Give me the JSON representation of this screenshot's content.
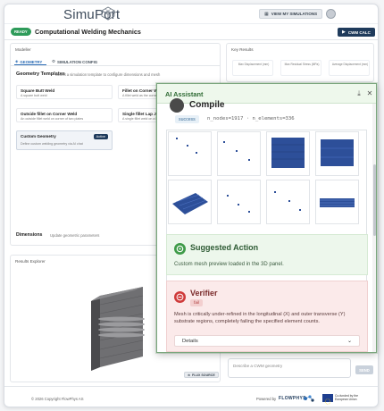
{
  "app": {
    "name": "SimuPort"
  },
  "header": {
    "view_simulations_label": "VIEW MY SIMULATIONS"
  },
  "titlebar": {
    "status_badge": "READY",
    "title": "Computational Welding Mechanics",
    "cwm_button_label": "CWM CALC"
  },
  "modeller": {
    "section_title": "Modeller",
    "tabs": [
      {
        "label": "GEOMETRY",
        "active": true
      },
      {
        "label": "SIMULATION CONFIG",
        "active": false
      }
    ],
    "geometry_templates_title": "Geometry Templates",
    "geometry_templates_sub": "Select a simulation template to configure dimensions and mesh",
    "templates": [
      {
        "title": "Square Butt Weld",
        "desc": "A square butt weld"
      },
      {
        "title": "Fillet on Corner Weld",
        "desc": "A fillet weld as the corner weld"
      },
      {
        "title": "Outside fillet on Corner Weld",
        "desc": "An outside fillet weld on corner of two plates"
      },
      {
        "title": "Single fillet Lap Joint",
        "desc": "A single fillet weld on a lap joint"
      },
      {
        "title": "Custom Geometry",
        "desc": "Define custom welding geometry via AI chat",
        "badge": "Active"
      }
    ],
    "dimensions_title": "Dimensions",
    "dimensions_sub": "Update geometric parameters"
  },
  "explorer": {
    "title": "Results Explorer",
    "flux_button_label": "FLUX SOURCE"
  },
  "key_results": {
    "title": "Key Results",
    "boxes": [
      "Max Displacement (mm)",
      "Max Residual Stress (MPa)",
      "Average Displacement (mm)"
    ]
  },
  "assistant": {
    "title": "AI Assistant",
    "compile": {
      "title": "Compile",
      "status": "success",
      "stats": "n_nodes=1917 · n_elements=336"
    },
    "suggested": {
      "title": "Suggested Action",
      "text": "Custom mesh preview loaded in the 3D panel."
    },
    "verifier": {
      "title": "Verifier",
      "status": "fail",
      "text": "Mesh is critically under-refined in the longitudinal (X) and outer transverse (Y) substrate regions, completely failing the specified element counts.",
      "details_label": "Details"
    }
  },
  "chat": {
    "placeholder": "Describe a CWM geometry",
    "send_label": "SEND"
  },
  "footer": {
    "copyright": "© 2026 Copyright FlowPhys AS",
    "powered_by": "Powered by",
    "brand": "FLOWPHYS",
    "eu_text": "Co-funded by the European Union"
  },
  "colors": {
    "accent": "#1f3b5c",
    "success": "#3f9b49",
    "danger": "#cf3b3b",
    "mesh": "#2d4f99"
  }
}
